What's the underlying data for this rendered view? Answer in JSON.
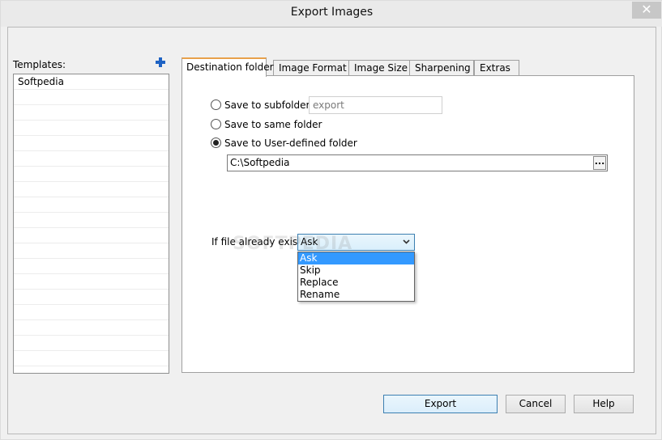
{
  "window": {
    "title": "Export Images",
    "close_glyph": "✕"
  },
  "templates": {
    "label": "Templates:",
    "items": [
      "Softpedia"
    ],
    "empty_rows": 18
  },
  "tabs": [
    "Destination folder",
    "Image Format",
    "Image Size",
    "Sharpening",
    "Extras"
  ],
  "active_tab": 0,
  "destination": {
    "options": [
      {
        "label": "Save to subfolder:",
        "checked": false
      },
      {
        "label": "Save to same folder",
        "checked": false
      },
      {
        "label": "Save to User-defined folder",
        "checked": true
      }
    ],
    "subfolder_value": "export",
    "path_value": "C:\\Softpedia",
    "browse_label": "...",
    "exists_label": "If file already exists:",
    "exists_selected": "Ask",
    "exists_options": [
      "Ask",
      "Skip",
      "Replace",
      "Rename"
    ]
  },
  "watermark": "SOFTPEDIA",
  "buttons": {
    "export": "Export",
    "cancel": "Cancel",
    "help": "Help"
  },
  "colors": {
    "accent": "#3399ff",
    "tab_accent": "#e8a14b",
    "plus": "#1f63c4"
  }
}
